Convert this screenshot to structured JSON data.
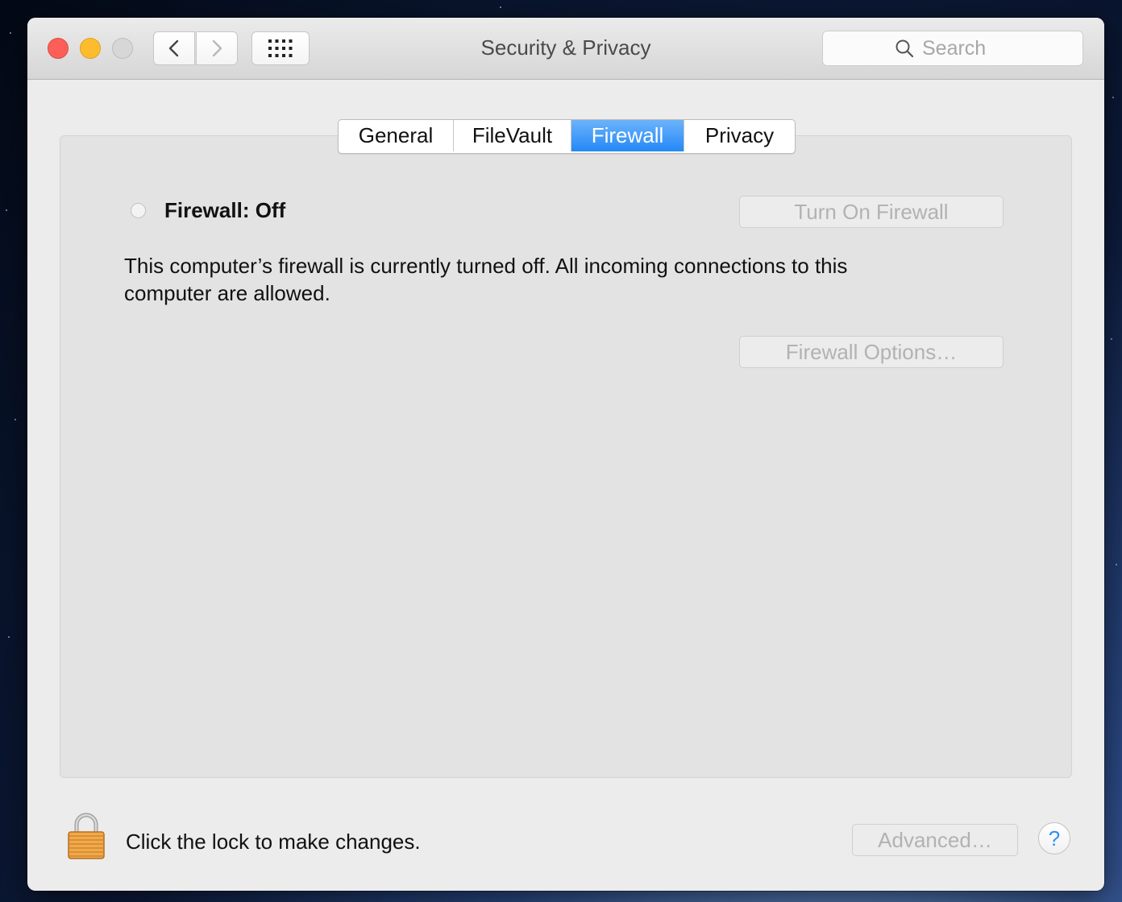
{
  "window": {
    "title": "Security & Privacy",
    "traffic_lights": [
      "close",
      "minimize",
      "zoom"
    ]
  },
  "toolbar": {
    "back_icon": "chevron-left-icon",
    "forward_icon": "chevron-right-icon",
    "show_all_icon": "grid-icon"
  },
  "search": {
    "placeholder": "Search",
    "value": ""
  },
  "tabs": [
    {
      "label": "General",
      "selected": false
    },
    {
      "label": "FileVault",
      "selected": false
    },
    {
      "label": "Firewall",
      "selected": true
    },
    {
      "label": "Privacy",
      "selected": false
    }
  ],
  "firewall": {
    "status_label": "Firewall: Off",
    "status_on": false,
    "turn_on_label": "Turn On Firewall",
    "description": "This computer’s firewall is currently turned off. All incoming connections to this computer are allowed.",
    "options_label": "Firewall Options…"
  },
  "footer": {
    "lock_text": "Click the lock to make changes.",
    "advanced_label": "Advanced…",
    "help_label": "?"
  },
  "colors": {
    "close": "#fc5f57",
    "minimize": "#fdbc2e",
    "zoom": "#d7d7d7",
    "selected_tab": "#2488f7",
    "disabled_text": "#b2b2b2",
    "help_accent": "#2f8ef5"
  }
}
